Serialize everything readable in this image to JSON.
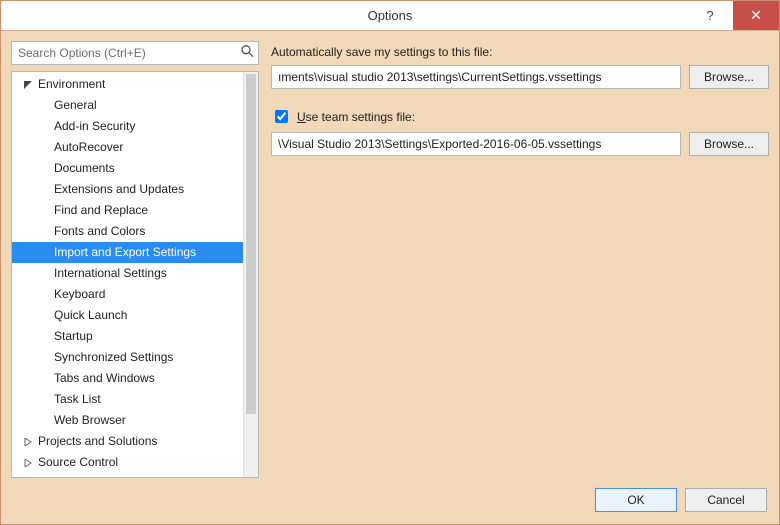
{
  "window": {
    "title": "Options",
    "help_icon": "?",
    "close_icon": "✕"
  },
  "search": {
    "placeholder": "Search Options (Ctrl+E)"
  },
  "tree": {
    "env_label": "Environment",
    "items": [
      "General",
      "Add-in Security",
      "AutoRecover",
      "Documents",
      "Extensions and Updates",
      "Find and Replace",
      "Fonts and Colors",
      "Import and Export Settings",
      "International Settings",
      "Keyboard",
      "Quick Launch",
      "Startup",
      "Synchronized Settings",
      "Tabs and Windows",
      "Task List",
      "Web Browser"
    ],
    "projects_label": "Projects and Solutions",
    "source_control_label": "Source Control"
  },
  "panel": {
    "auto_save_label": "Automatically save my settings to this file:",
    "auto_save_path": "ıments\\visual studio 2013\\settings\\CurrentSettings.vssettings",
    "browse_label": "Browse...",
    "use_team_label_pre": "U",
    "use_team_label_rest": "se team settings file:",
    "team_path": "\\Visual Studio 2013\\Settings\\Exported-2016-06-05.vssettings",
    "team_checked": true
  },
  "footer": {
    "ok": "OK",
    "cancel": "Cancel"
  }
}
